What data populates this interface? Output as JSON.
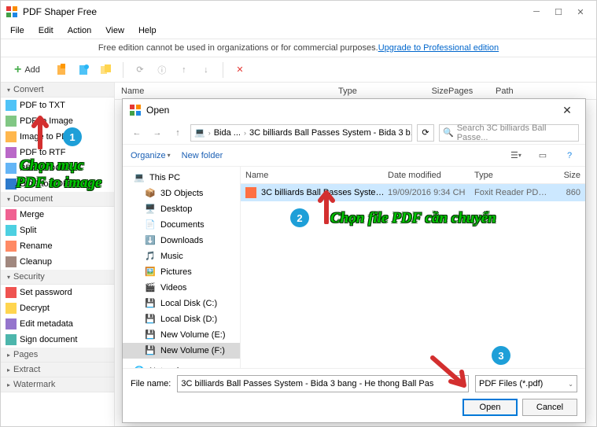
{
  "app": {
    "title": "PDF Shaper Free"
  },
  "menu": [
    "File",
    "Edit",
    "Action",
    "View",
    "Help"
  ],
  "infobar": {
    "text": "Free edition cannot be used in organizations or for commercial purposes. ",
    "link": "Upgrade to Professional edition"
  },
  "toolbar": {
    "add": "Add"
  },
  "sidebar": {
    "groups": [
      {
        "label": "Convert",
        "items": [
          "PDF to TXT",
          "PDF to Image",
          "Image to PDF",
          "PDF to RTF",
          "PDF to DOC",
          "DOC to PDF"
        ]
      },
      {
        "label": "Document",
        "items": [
          "Merge",
          "Split",
          "Rename",
          "Cleanup"
        ]
      },
      {
        "label": "Security",
        "items": [
          "Set password",
          "Decrypt",
          "Edit metadata",
          "Sign document"
        ]
      },
      {
        "label": "Pages",
        "items": []
      },
      {
        "label": "Extract",
        "items": []
      },
      {
        "label": "Watermark",
        "items": []
      }
    ]
  },
  "list_cols": {
    "name": "Name",
    "type": "Type",
    "size": "Size",
    "pages": "Pages",
    "path": "Path"
  },
  "dialog": {
    "title": "Open",
    "breadcrumb": [
      "Bida ...",
      "3C billiards Ball Passes System - Bida 3 b..."
    ],
    "search_placeholder": "Search 3C billiards Ball Passe...",
    "organize": "Organize",
    "new_folder": "New folder",
    "tree": {
      "root": "This PC",
      "items": [
        "3D Objects",
        "Desktop",
        "Documents",
        "Downloads",
        "Music",
        "Pictures",
        "Videos",
        "Local Disk (C:)",
        "Local Disk (D:)",
        "New Volume (E:)",
        "New Volume (F:)"
      ],
      "network": "Network"
    },
    "cols": {
      "name": "Name",
      "date": "Date modified",
      "type": "Type",
      "size": "Size"
    },
    "file": {
      "name": "3C billiards Ball Passes System - Bida 3 b...",
      "date": "19/09/2016 9:34 CH",
      "type": "Foxit Reader PDF ...",
      "size": "860"
    },
    "fn_label": "File name:",
    "fn_value": "3C billiards Ball Passes System - Bida 3 bang - He thong Ball Pas",
    "filter": "PDF Files (*.pdf)",
    "open": "Open",
    "cancel": "Cancel"
  },
  "anno": {
    "t1a": "Chọn mục",
    "t1b": "PDF to image",
    "t2": "Chọn file PDF cần chuyển",
    "b1": "1",
    "b2": "2",
    "b3": "3"
  }
}
